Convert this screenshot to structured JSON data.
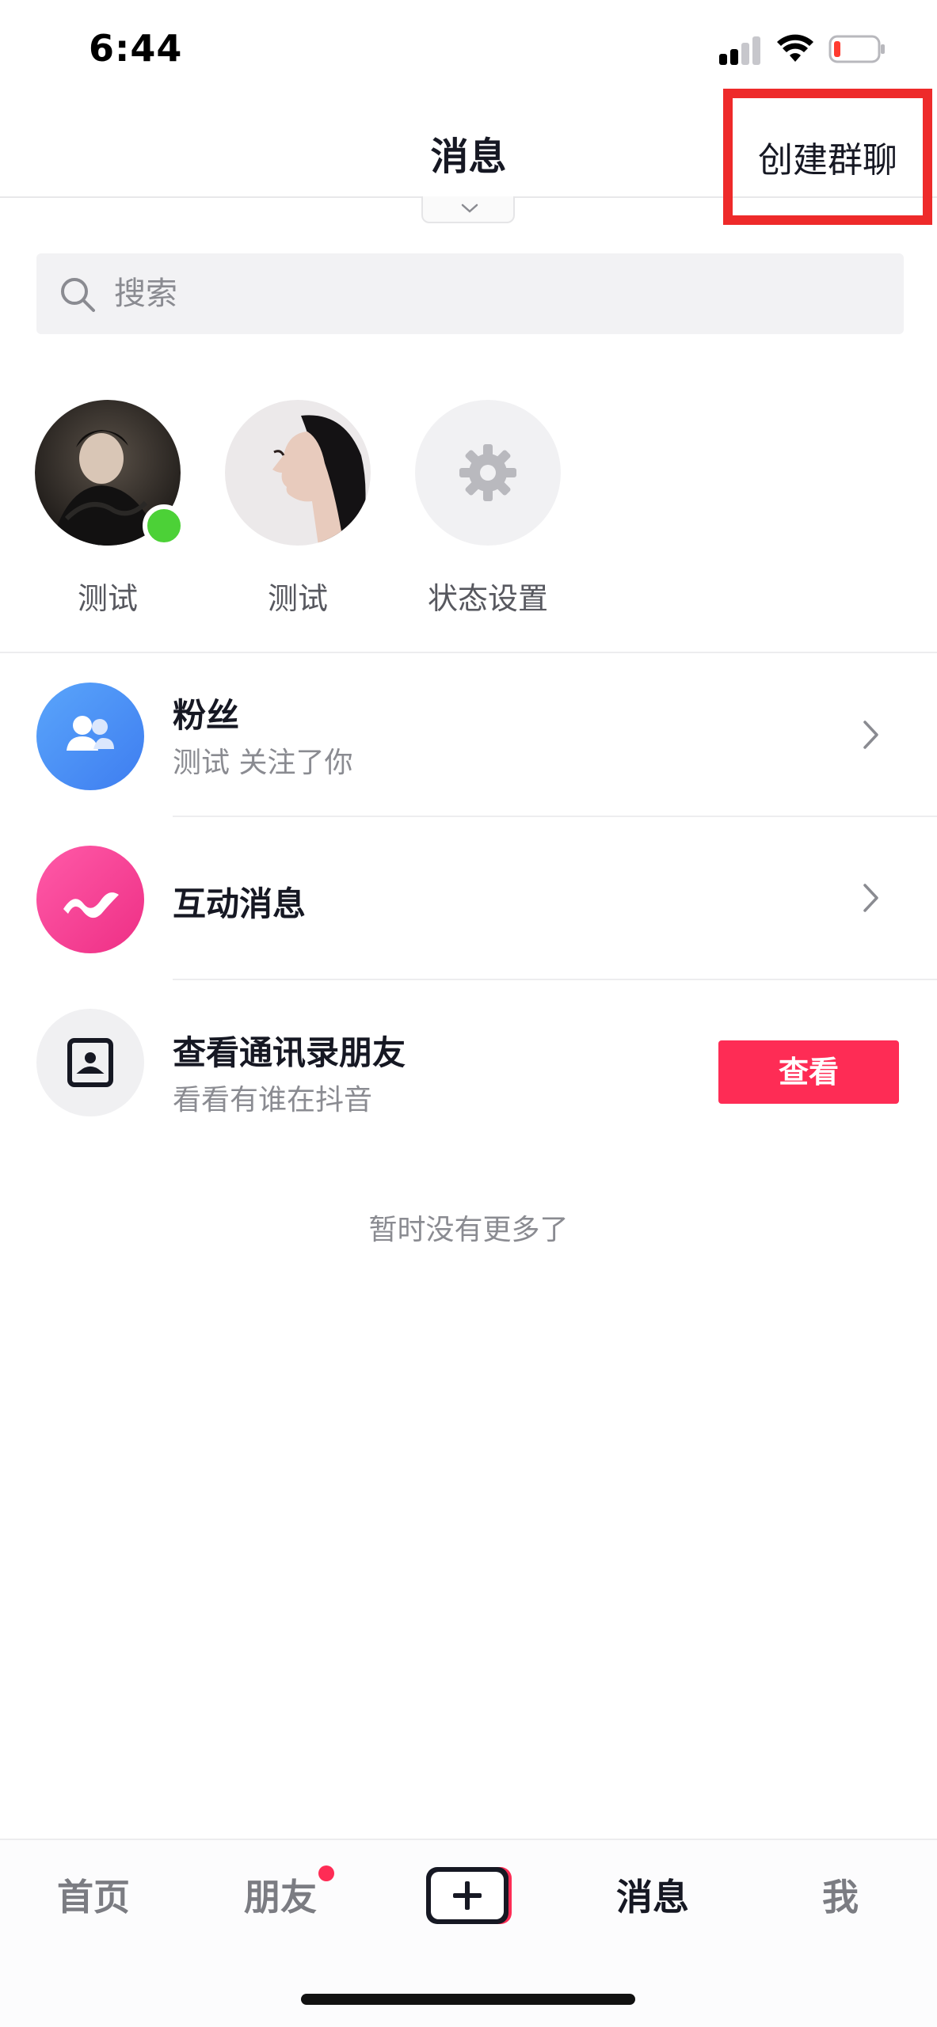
{
  "status_bar": {
    "time": "6:44"
  },
  "header": {
    "title": "消息",
    "create_group": "创建群聊"
  },
  "search": {
    "placeholder": "搜索"
  },
  "contacts": [
    {
      "label": "测试",
      "online": true
    },
    {
      "label": "测试",
      "online": false
    },
    {
      "label": "状态设置",
      "icon": "gear-icon"
    }
  ],
  "list": {
    "fans": {
      "title": "粉丝",
      "subtitle": "测试 关注了你"
    },
    "interactions": {
      "title": "互动消息"
    },
    "address_book": {
      "title": "查看通讯录朋友",
      "subtitle": "看看有谁在抖音",
      "button": "查看"
    }
  },
  "no_more": "暂时没有更多了",
  "tabbar": {
    "home": "首页",
    "friends": "朋友",
    "messages": "消息",
    "me": "我"
  },
  "colors": {
    "accent": "#fe2c55",
    "highlight_box": "#ee2a2a",
    "online": "#4cd137",
    "fans_icon": "#4a8ff5",
    "interaction_icon": "#f2398d"
  }
}
